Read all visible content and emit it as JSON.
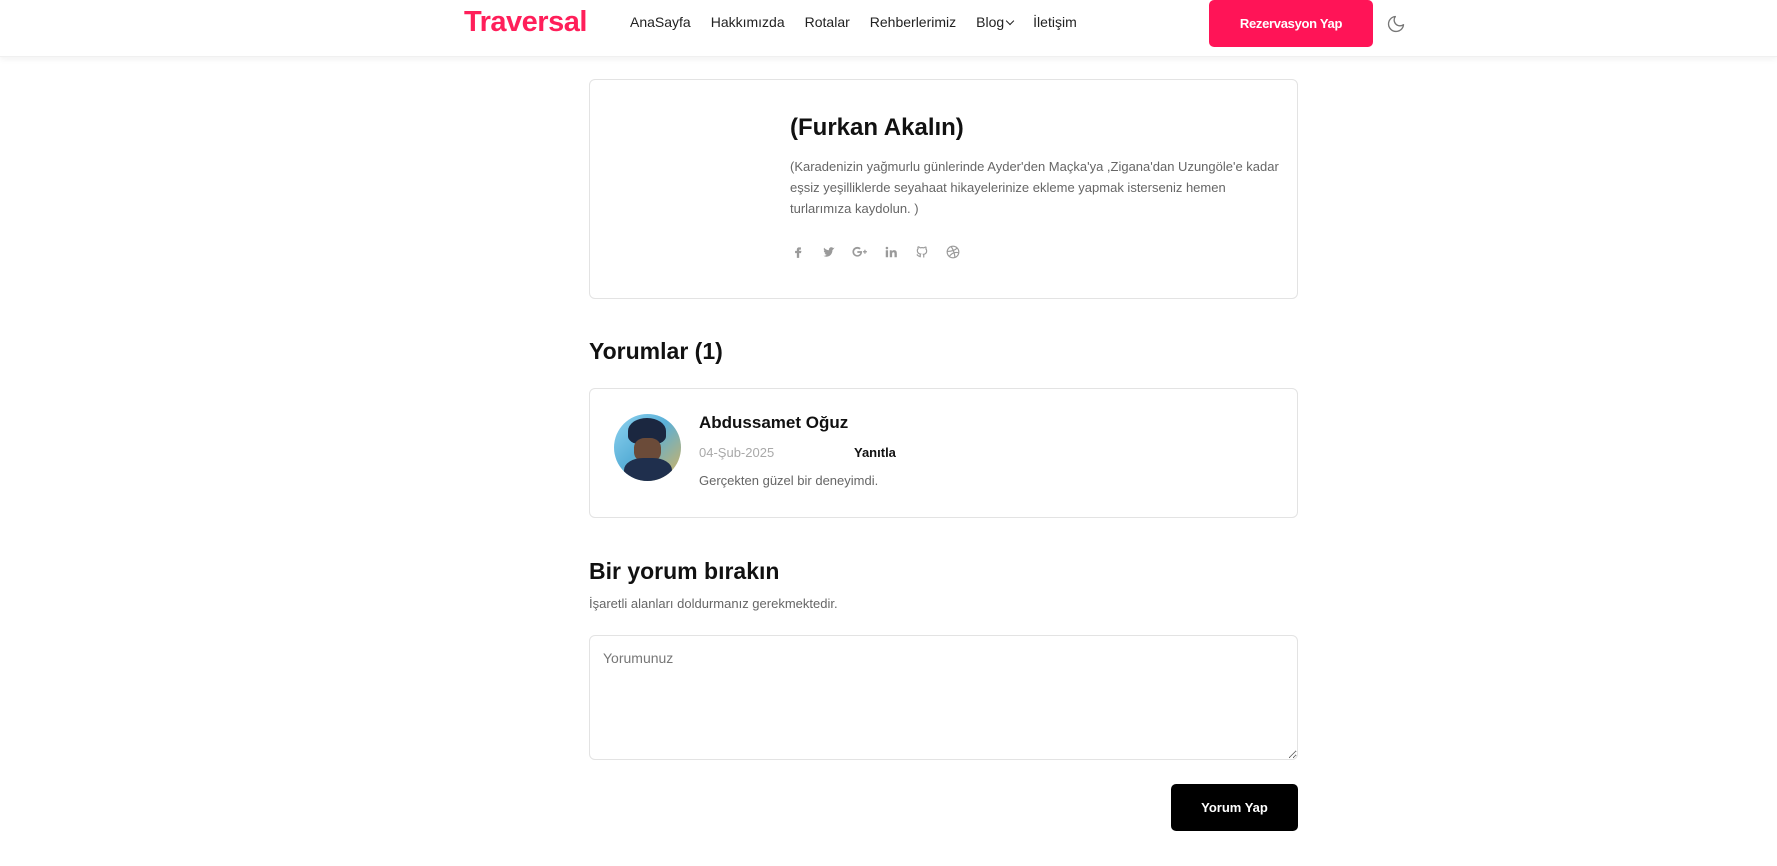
{
  "header": {
    "logo": "Traversal",
    "nav": [
      {
        "label": "AnaSayfa"
      },
      {
        "label": "Hakkımızda"
      },
      {
        "label": "Rotalar"
      },
      {
        "label": "Rehberlerimiz"
      },
      {
        "label": "Blog",
        "has_dropdown": true
      },
      {
        "label": "İletişim"
      }
    ],
    "reserve_label": "Rezervasyon Yap",
    "theme_icon": "moon-icon"
  },
  "author": {
    "name": "(Furkan Akalın)",
    "bio": "(Karadenizin yağmurlu günlerinde Ayder'den Maçka'ya ,Zigana'dan Uzungöle'e kadar eşsiz yeşilliklerde seyahaat hikayelerinize ekleme yapmak isterseniz hemen turlarımıza kaydolun. )",
    "socials": [
      "facebook-icon",
      "twitter-icon",
      "google-plus-icon",
      "linkedin-icon",
      "github-icon",
      "dribbble-icon"
    ]
  },
  "comments": {
    "title": "Yorumlar (1)",
    "items": [
      {
        "author": "Abdussamet Oğuz",
        "date": "04-Şub-2025",
        "reply_label": "Yanıtla",
        "text": "Gerçekten güzel bir deneyimdi."
      }
    ]
  },
  "form": {
    "title": "Bir yorum bırakın",
    "note": "İşaretli alanları doldurmanız gerekmektedir.",
    "placeholder": "Yorumunuz",
    "submit_label": "Yorum Yap"
  },
  "colors": {
    "brand": "#ff1f5a",
    "reserve_button": "#ff1457",
    "submit_button": "#000000"
  }
}
